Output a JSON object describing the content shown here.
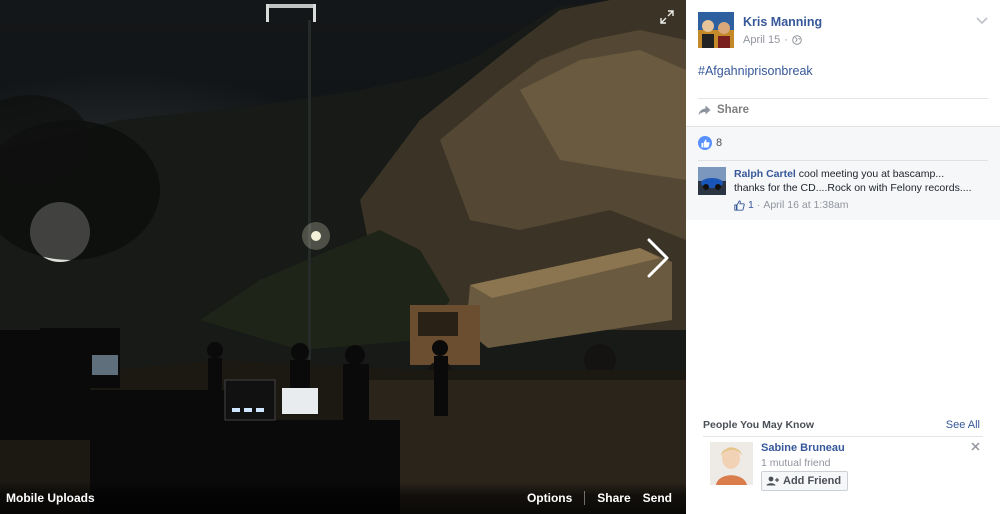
{
  "photo": {
    "album_label": "Mobile Uploads",
    "actions": {
      "options_label": "Options",
      "share_label": "Share",
      "send_label": "Send"
    }
  },
  "post": {
    "author": "Kris Manning",
    "date": "April 15",
    "privacy": "globe-icon",
    "caption": "#Afgahniprisonbreak",
    "share_label": "Share",
    "like_count": "8"
  },
  "comments": [
    {
      "author": "Ralph Cartel",
      "text_line1": "cool meeting you at bascamp...",
      "text_line2": "thanks for the CD....Rock on with Felony records....",
      "likes": "1",
      "time": "April 16 at 1:38am"
    }
  ],
  "people_you_may_know": {
    "title": "People You May Know",
    "see_all_label": "See All",
    "suggestions": [
      {
        "name": "Sabine Bruneau",
        "mutual": "1 mutual friend",
        "button_label": "Add Friend"
      }
    ]
  },
  "colors": {
    "link_blue": "#365899",
    "like_blue": "#5890ff",
    "panel_bg": "#ffffff",
    "comment_bg": "#f6f7f9"
  }
}
